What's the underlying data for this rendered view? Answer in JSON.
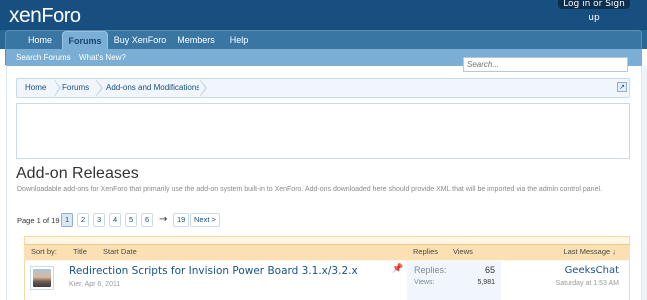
{
  "header": {
    "logo_main": "xen",
    "logo_second": "Foro",
    "login_label": "Log in or Sign up"
  },
  "nav": {
    "tabs": [
      {
        "label": "Home"
      },
      {
        "label": "Forums"
      },
      {
        "label": "Buy XenForo"
      },
      {
        "label": "Members"
      },
      {
        "label": "Help"
      }
    ],
    "selected_tab": "Forums",
    "sub_links": [
      {
        "label": "Search Forums"
      },
      {
        "label": "What's New?"
      }
    ]
  },
  "search": {
    "placeholder": "Search..."
  },
  "breadcrumb": {
    "items": [
      {
        "label": "Home"
      },
      {
        "label": "Forums"
      },
      {
        "label": "Add-ons and Modifications"
      }
    ],
    "jump_icon": "arrow-jump-icon"
  },
  "main": {
    "title": "Add-on Releases",
    "description": "Downloadable add-ons for XenForo that primarily use the add-on system built-in to XenForo. Add-ons downloaded here should provide XML that will be imported via the admin control panel."
  },
  "pagination": {
    "page_of": "Page 1 of 19",
    "pages": [
      "1",
      "2",
      "3",
      "4",
      "5",
      "6"
    ],
    "arrow": "→",
    "last_page": "19",
    "next_label": "Next >"
  },
  "thread_list": {
    "headers": {
      "sort_by": "Sort by:",
      "title": "Title",
      "start_date": "Start Date",
      "replies": "Replies",
      "views": "Views",
      "last_message": "Last Message ↓"
    },
    "threads": [
      {
        "title": "Redirection Scripts for Invision Power Board 3.1.x/3.2.x",
        "meta": "Kier, Apr 6, 2011",
        "pinned_icon": "pin-icon",
        "replies_label": "Replies:",
        "replies": "65",
        "views_label": "Views:",
        "views": "5,981",
        "last_user": "GeeksChat",
        "last_time": "Saturday at 1:53 AM"
      }
    ]
  },
  "colors": {
    "header_bg": "#175080",
    "nav_bg": "#3a76a3",
    "subnav_bg": "#7aaed4",
    "thread_header_bg": "#fbe0b3",
    "link": "#1b5288"
  }
}
